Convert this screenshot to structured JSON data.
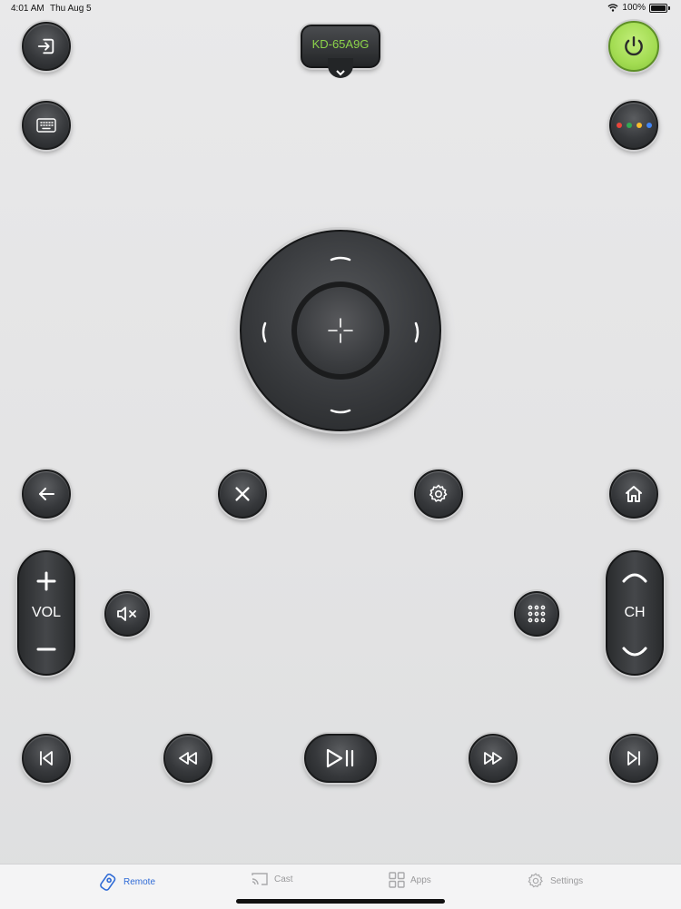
{
  "status_bar": {
    "time": "4:01 AM",
    "date": "Thu Aug 5",
    "battery": "100%"
  },
  "device": {
    "name": "KD-65A9G"
  },
  "colors": {
    "power": "#a3dc52",
    "device_text": "#8cd34a",
    "accent": "#2f6bd6",
    "assistant_dots": [
      "#e8453c",
      "#34a853",
      "#f9bb2d",
      "#4285f4"
    ]
  },
  "volume": {
    "label": "VOL"
  },
  "channel": {
    "label": "CH"
  },
  "icons": {
    "input": "input-icon",
    "power": "power-icon",
    "keyboard": "keyboard-icon",
    "assistant": "assistant-dots-icon",
    "back": "back-arrow-icon",
    "close": "close-icon",
    "settings": "gear-icon",
    "home": "home-icon",
    "mute": "mute-icon",
    "numpad": "numpad-icon",
    "previous": "skip-previous-icon",
    "rewind": "rewind-icon",
    "play_pause": "play-pause-icon",
    "fast_forward": "fast-forward-icon",
    "next": "skip-next-icon"
  },
  "tabs": [
    {
      "label": "Remote",
      "icon": "remote-icon",
      "active": true
    },
    {
      "label": "Cast",
      "icon": "cast-icon",
      "active": false
    },
    {
      "label": "Apps",
      "icon": "apps-grid-icon",
      "active": false
    },
    {
      "label": "Settings",
      "icon": "gear-icon",
      "active": false
    }
  ]
}
